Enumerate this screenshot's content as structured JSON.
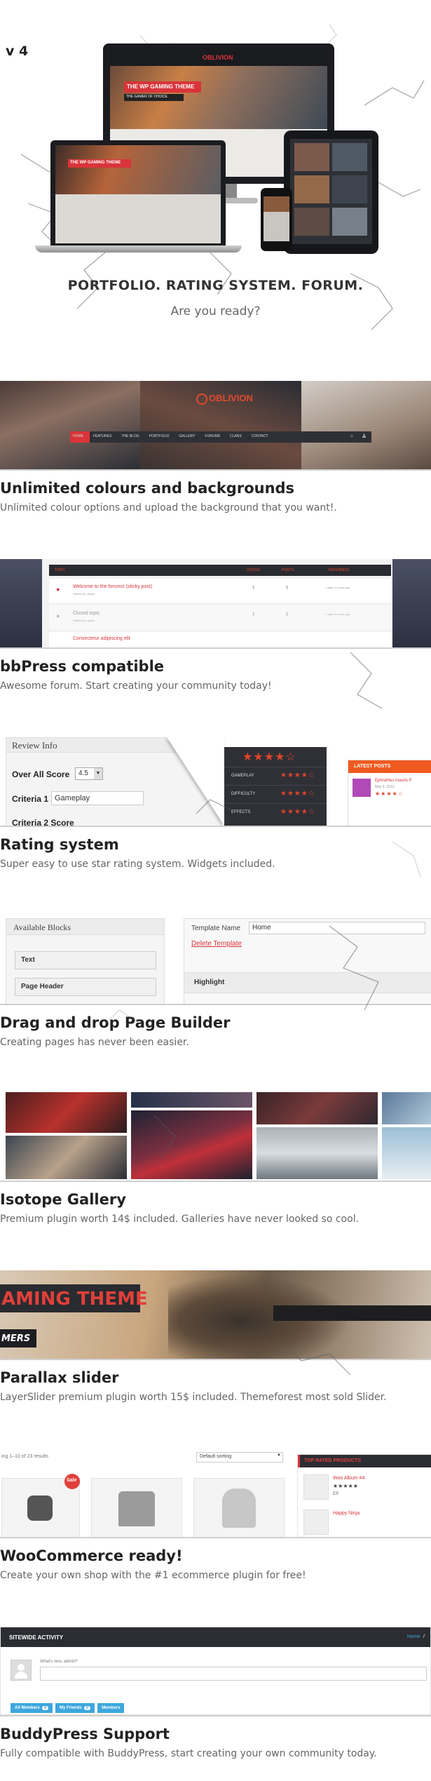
{
  "version": "v 4",
  "hero": {
    "tagline": "PORTFOLIO. RATING SYSTEM. FORUM.",
    "subtitle": "Are you ready?",
    "monitor": {
      "logo": "OBLIVION",
      "banner_title": "THE WP GAMING THEME",
      "banner_sub": "THE GAMER OF CHOICE"
    },
    "laptop": {
      "banner_title": "THE WP GAMING THEME"
    }
  },
  "nav_strip": {
    "logo": "OBLIVION",
    "menu": [
      "HOME",
      "FEATURES",
      "THE BLOG",
      "PORTFOLIO",
      "GALLERY",
      "FORUMS",
      "CLANS",
      "CONTACT"
    ]
  },
  "sections": [
    {
      "title": "Unlimited colours and backgrounds",
      "desc": "Unlimited colour options and upload the background that you want!."
    },
    {
      "title": "bbPress compatible",
      "desc": "Awesome forum. Start creating your community today!"
    },
    {
      "title": "Rating system",
      "desc": "Super easy to use star rating system. Widgets included."
    },
    {
      "title": "Drag and drop Page Builder",
      "desc": "Creating pages has never been easier."
    },
    {
      "title": "Isotope Gallery",
      "desc": "Premium plugin worth 14$ included. Galleries have never looked so cool."
    },
    {
      "title": "Parallax slider",
      "desc": "LayerSlider premium plugin worth 15$ included. Themeforest most sold Slider."
    },
    {
      "title": "WooCommerce ready!",
      "desc": "Create your own shop with the #1 ecommerce plugin for free!"
    },
    {
      "title": "BuddyPress Support",
      "desc": "Fully compatible with BuddyPress, start creating your own community today."
    }
  ],
  "forum": {
    "headers": [
      "TOPIC",
      "VOICES",
      "POSTS",
      "FRESHNESS"
    ],
    "rows": [
      {
        "title": "Welcome to the forums! (sticky post)",
        "by": "Started by: admin",
        "voices": "1",
        "posts": "1",
        "fresh": "1 days, 4 hours ago"
      },
      {
        "title": "Closed topic",
        "by": "Started by: admin",
        "voices": "1",
        "posts": "1",
        "fresh": "1 days, 4 hours ago"
      },
      {
        "title": "Consectetur adipiscing elit",
        "by": "",
        "voices": "",
        "posts": "",
        "fresh": ""
      }
    ]
  },
  "rating": {
    "panel_title": "Review Info",
    "overall_label": "Over All Score",
    "overall_value": "4.5",
    "crit1_label": "Criteria 1",
    "crit1_value": "Gameplay",
    "crit2_label": "Criteria 2 Score",
    "crit_rows": [
      "GAMEPLAY",
      "DIFFICULTY",
      "EFFECTS"
    ],
    "latest_title": "LATEST POSTS",
    "latest_item": "Ephrathes mauris P",
    "latest_date": "May 8, 2013",
    "stars_full": "★★★★",
    "star_half": "☆",
    "stars_five": "★★★★★",
    "stars_row": "★★★★☆"
  },
  "builder": {
    "left_title": "Available Blocks",
    "blocks": [
      "Text",
      "Page Header"
    ],
    "template_label": "Template Name",
    "template_value": "Home",
    "delete_label": "Delete Template",
    "highlight_label": "Highlight"
  },
  "slider": {
    "line1": "AMING THEME",
    "line2": "MERS"
  },
  "shop": {
    "results": "ing 1–10 of 23 results",
    "sort": "Default sorting",
    "sale": "Sale",
    "top_title": "TOP RATED PRODUCTS",
    "product1": "Woo Album #4",
    "product1_price": "£9",
    "product2": "Happy Ninja",
    "stars": "★★★★★"
  },
  "buddy": {
    "header": "SITEWIDE ACTIVITY",
    "crumb_home": "Home",
    "crumb_sep": "/",
    "prompt": "What's new, admin?",
    "tabs": [
      {
        "label": "All Members",
        "count": "4"
      },
      {
        "label": "My Friends",
        "count": "0"
      },
      {
        "label": "Members",
        "count": ""
      }
    ]
  },
  "colors": {
    "accent": "#d9343a",
    "dark": "#2b2d33",
    "orange": "#ef5a1f",
    "blue": "#3ea7dd"
  }
}
